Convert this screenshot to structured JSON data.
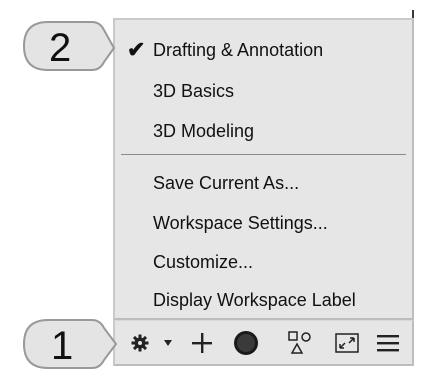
{
  "workspace_menu": {
    "items": [
      {
        "label": "Drafting & Annotation",
        "checked": true
      },
      {
        "label": "3D Basics",
        "checked": false
      },
      {
        "label": "3D Modeling",
        "checked": false
      },
      {
        "label": "Save Current As...",
        "checked": false
      },
      {
        "label": "Workspace Settings...",
        "checked": false
      },
      {
        "label": "Customize...",
        "checked": false
      },
      {
        "label": "Display Workspace Label",
        "checked": false
      }
    ],
    "check_mark": "✔"
  },
  "callouts": {
    "top": "2",
    "bottom": "1"
  },
  "status_bar": {
    "icons": [
      "gear-icon",
      "dropdown-arrow-icon",
      "plus-icon",
      "dark-circle-icon",
      "shapes-icon",
      "fullscreen-icon",
      "hamburger-menu-icon"
    ]
  },
  "colors": {
    "menu_bg": "#e6e6e6",
    "callout_fill": "#e4e4e4",
    "callout_stroke": "#999999"
  }
}
